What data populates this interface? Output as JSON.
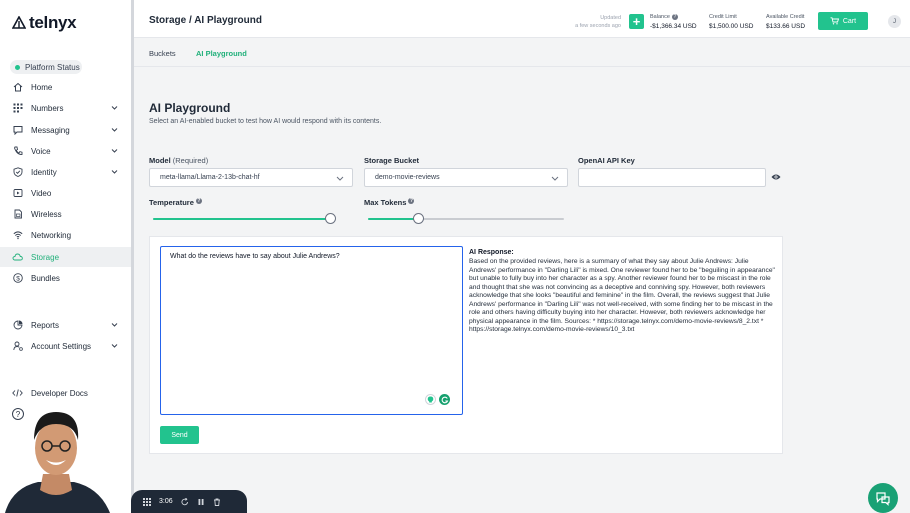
{
  "brand": {
    "name": "telnyx",
    "accent": "#22c38e"
  },
  "sidebar": {
    "platform_status": "Platform Status",
    "items": [
      {
        "label": "Home",
        "icon": "home-icon",
        "has_chevron": false
      },
      {
        "label": "Numbers",
        "icon": "grid-icon",
        "has_chevron": true
      },
      {
        "label": "Messaging",
        "icon": "message-icon",
        "has_chevron": true
      },
      {
        "label": "Voice",
        "icon": "phone-icon",
        "has_chevron": true
      },
      {
        "label": "Identity",
        "icon": "shield-icon",
        "has_chevron": true
      },
      {
        "label": "Video",
        "icon": "video-icon",
        "has_chevron": false
      },
      {
        "label": "Wireless",
        "icon": "sim-icon",
        "has_chevron": false
      },
      {
        "label": "Networking",
        "icon": "wifi-icon",
        "has_chevron": false
      },
      {
        "label": "Storage",
        "icon": "cloud-icon",
        "has_chevron": false,
        "active": true
      },
      {
        "label": "Bundles",
        "icon": "dollar-icon",
        "has_chevron": false
      },
      {
        "label": "Reports",
        "icon": "chart-icon",
        "has_chevron": true
      },
      {
        "label": "Account Settings",
        "icon": "user-settings-icon",
        "has_chevron": true
      },
      {
        "label": "Developer Docs",
        "icon": "code-icon",
        "has_chevron": false
      }
    ],
    "help": "?"
  },
  "header": {
    "title": "Storage / AI Playground",
    "updated_label": "Updated",
    "updated_time": "a few seconds ago",
    "add_button": "+",
    "balance_label": "Balance",
    "balance_value": "-$1,366.34 USD",
    "credit_label": "Credit Limit",
    "credit_value": "$1,500.00 USD",
    "available_label": "Available Credit",
    "available_value": "$133.66 USD",
    "cart_label": "Cart",
    "avatar_initial": "J"
  },
  "tabs": [
    {
      "label": "Buckets",
      "active": false
    },
    {
      "label": "AI Playground",
      "active": true
    }
  ],
  "main": {
    "title": "AI Playground",
    "subtitle": "Select an AI-enabled bucket to test how AI would respond with its contents.",
    "model_label": "Model",
    "model_required": "(Required)",
    "model_value": "meta-llama/Llama-2-13b-chat-hf",
    "bucket_label": "Storage Bucket",
    "bucket_value": "demo-movie-reviews",
    "api_key_label": "OpenAI API Key",
    "api_key_value": "",
    "temperature_label": "Temperature",
    "temperature_level": 0.98,
    "max_tokens_label": "Max Tokens",
    "max_tokens_level": 0.26,
    "prompt": "What do the reviews have to say about Julie Andrews?",
    "response_label": "AI Response:",
    "response_text": "Based on the provided reviews, here is a summary of what they say about Julie Andrews: Julie Andrews' performance in \"Darling Lili\" is mixed. One reviewer found her to be \"beguiling in appearance\" but unable to fully buy into her character as a spy. Another reviewer found her to be miscast in the role and thought that she was not convincing as a deceptive and conniving spy. However, both reviewers acknowledge that she looks \"beautiful and feminine\" in the film. Overall, the reviews suggest that Julie Andrews' performance in \"Darling Lili\" was not well-received, with some finding her to be miscast in the role and others having difficulty buying into her character. However, both reviewers acknowledge her physical appearance in the film. Sources: * https://storage.telnyx.com/demo-movie-reviews/8_2.txt * https://storage.telnyx.com/demo-movie-reviews/10_3.txt",
    "send_label": "Send"
  },
  "recorder": {
    "time": "3:06"
  }
}
